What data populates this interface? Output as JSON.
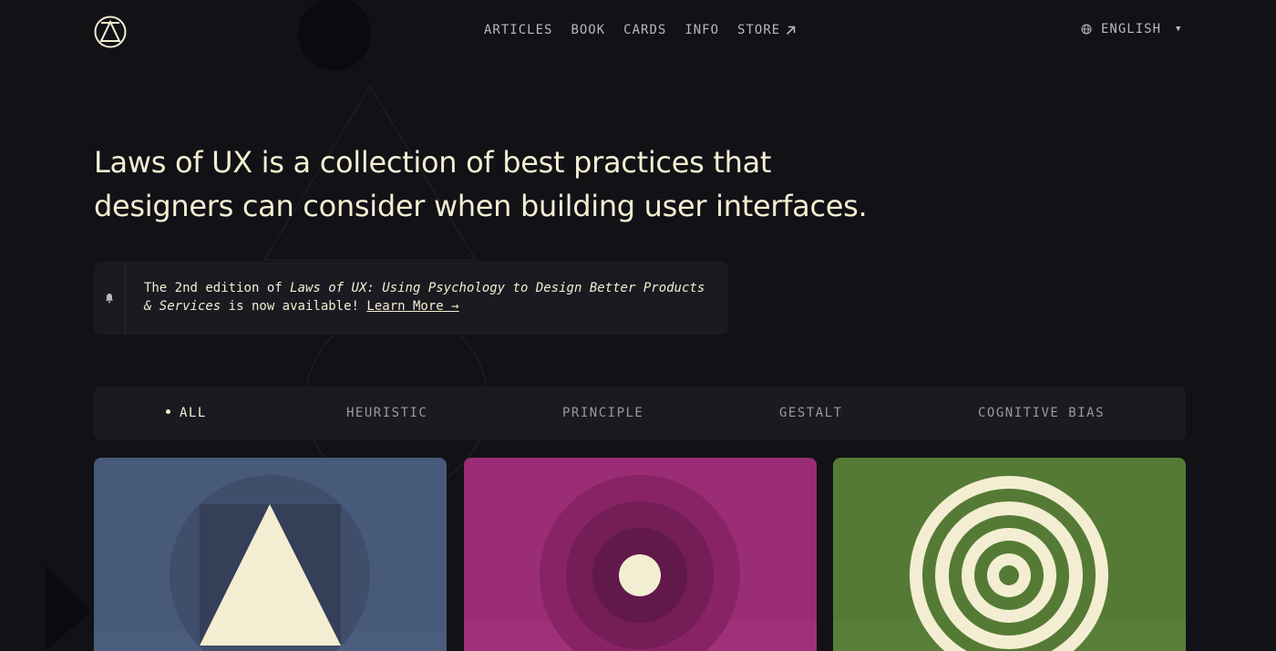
{
  "nav": {
    "logo_icon": "triangle-in-circle-logo-icon",
    "items": [
      {
        "label": "ARTICLES"
      },
      {
        "label": "BOOK"
      },
      {
        "label": "CARDS"
      },
      {
        "label": "INFO"
      },
      {
        "label": "STORE",
        "icon": "external-arrow-icon"
      }
    ]
  },
  "language": {
    "label": "ENGLISH",
    "icon": "globe-icon",
    "caret_icon": "caret-down-icon"
  },
  "hero": {
    "heading": "Laws of UX is a collection of best practices that designers can consider when building user interfaces."
  },
  "notice": {
    "icon": "bell-icon",
    "prefix": "The 2nd edition of ",
    "book_title": "Laws of UX: Using Psychology to Design Better Products & Services",
    "suffix": " is now available! ",
    "link": "Learn More →"
  },
  "filters": {
    "items": [
      {
        "label": "ALL",
        "active": true
      },
      {
        "label": "HEURISTIC",
        "active": false
      },
      {
        "label": "PRINCIPLE",
        "active": false
      },
      {
        "label": "GESTALT",
        "active": false
      },
      {
        "label": "COGNITIVE BIAS",
        "active": false
      }
    ]
  },
  "cards": [
    {
      "color": "#485a7a",
      "icon": "triangle-square-circle-icon"
    },
    {
      "color": "#9a2d76",
      "icon": "concentric-circles-dot-icon"
    },
    {
      "color": "#557a35",
      "icon": "target-rings-icon"
    }
  ],
  "colors": {
    "background": "#111116",
    "text": "#f3eed2",
    "panel": "#1a1a21",
    "muted": "#9a99a4"
  }
}
